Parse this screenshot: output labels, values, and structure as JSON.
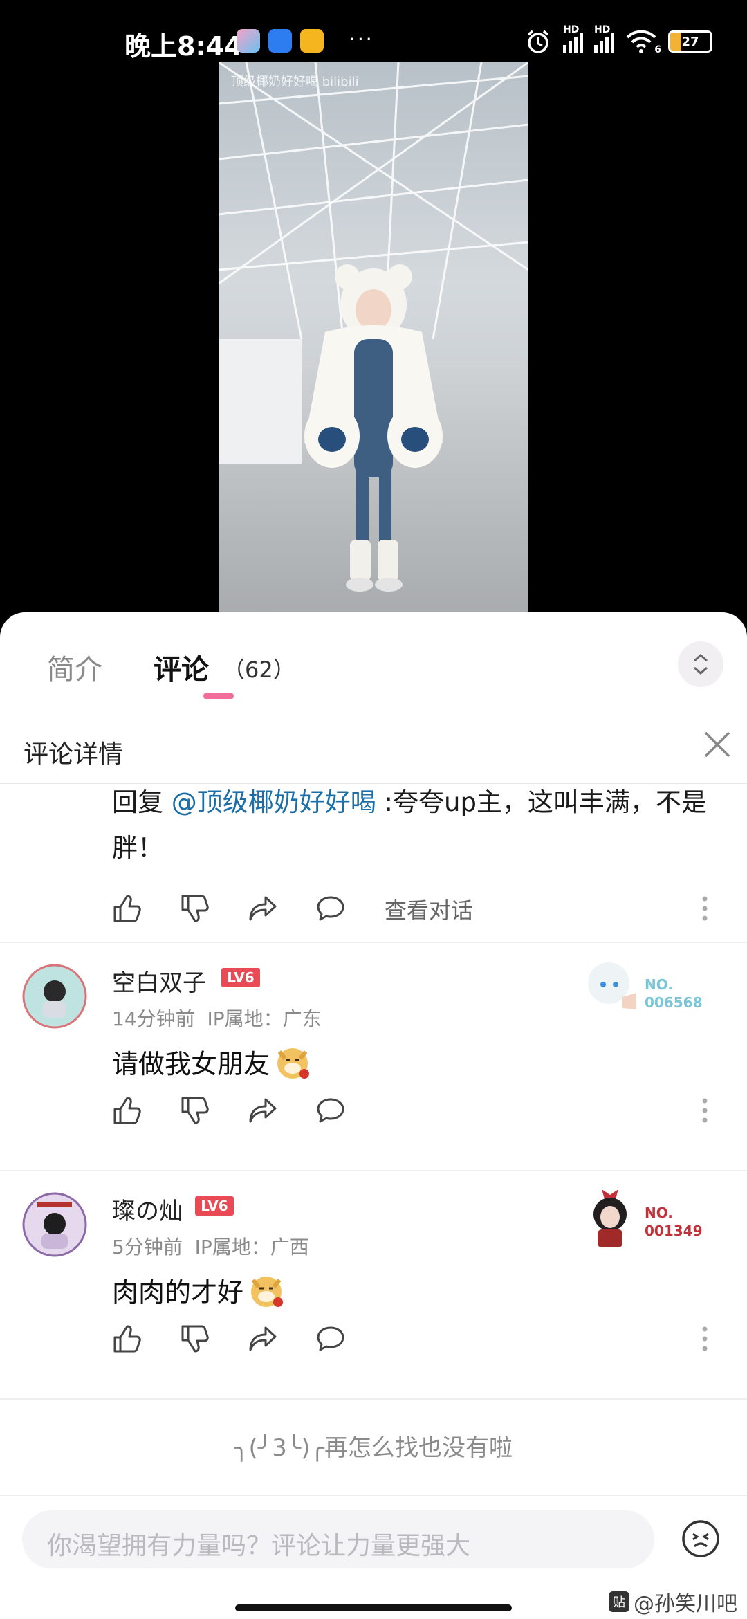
{
  "status_bar": {
    "time": "晚上8:44",
    "dots": "···",
    "signal1_label": "HD",
    "signal2_label": "HD",
    "wifi_label": "6",
    "battery_level": "27"
  },
  "video": {
    "watermark": "顶级椰奶好好喝 bilibili"
  },
  "tabs": {
    "intro": "简介",
    "comments": "评论",
    "comment_count": "（62）"
  },
  "detail": {
    "title": "评论详情"
  },
  "reply": {
    "prefix": "回复 ",
    "mention": "@顶级椰奶好好喝",
    "text": " :夸夸up主，这叫丰满，不是胖！",
    "view_conversation": "查看对话"
  },
  "comments": [
    {
      "username": "空白双子",
      "level": "LV6",
      "time": "14分钟前",
      "ip": "IP属地：广东",
      "text": "请做我女朋友",
      "fan_no_label": "NO.",
      "fan_no": "006568",
      "fan_color": "#79c6d6"
    },
    {
      "username": "璨の灿",
      "level": "LV6",
      "time": "5分钟前",
      "ip": "IP属地：广西",
      "text": "肉肉的才好",
      "fan_no_label": "NO.",
      "fan_no": "001349",
      "fan_color": "#c2303a"
    }
  ],
  "end_message": "╮(╯3╰)╭再怎么找也没有啦",
  "input": {
    "placeholder": "你渴望拥有力量吗？评论让力量更强大"
  },
  "corner_watermark": "@孙笑川吧",
  "colors": {
    "accent_pink": "#f26e9a",
    "mention_blue": "#1c6ea7",
    "level_red": "#e84b55"
  }
}
